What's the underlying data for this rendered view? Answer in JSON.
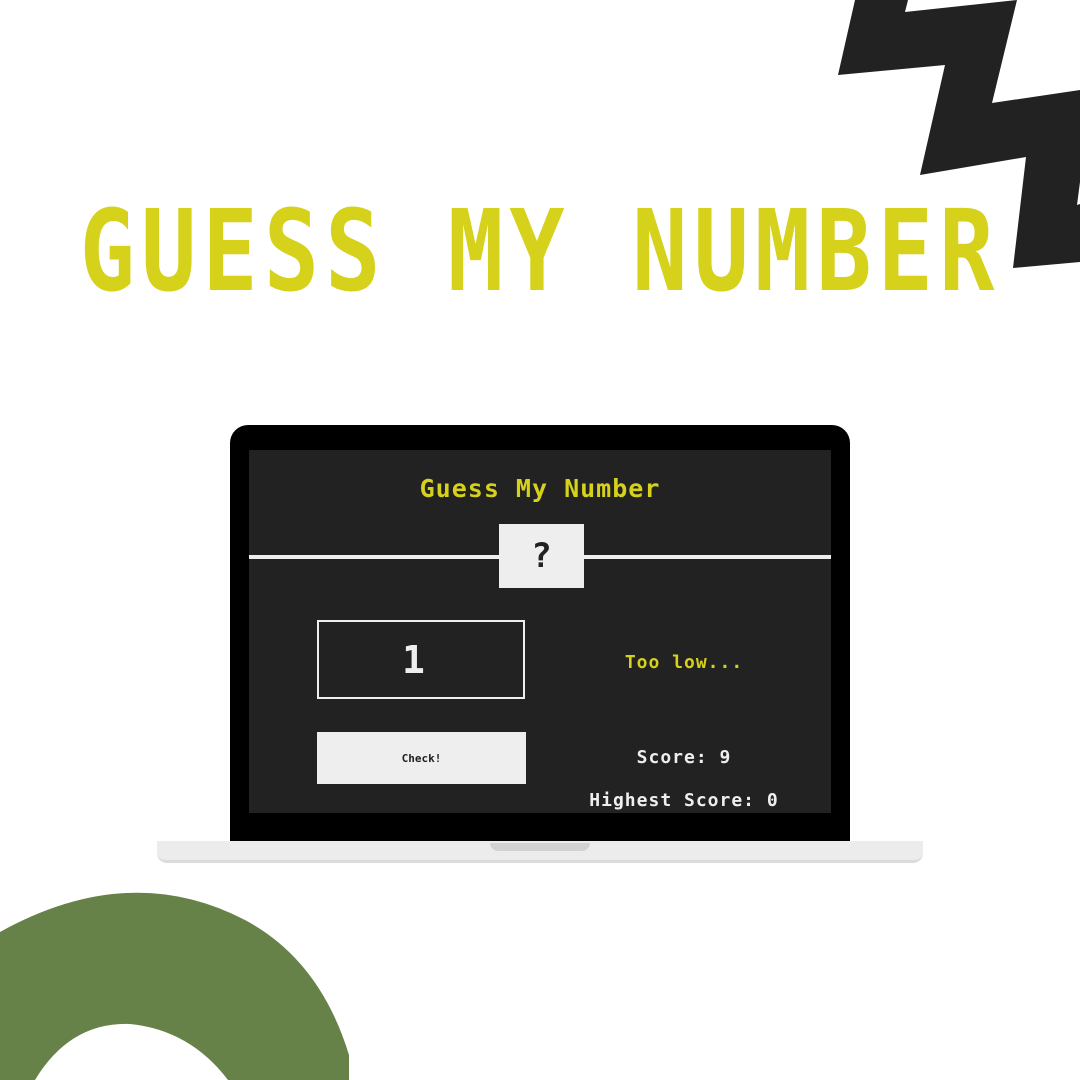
{
  "poster": {
    "headline": "GUESS MY NUMBER"
  },
  "game": {
    "title": "Guess My Number",
    "secret_number_display": "?",
    "guess_value": "1",
    "check_button_label": "Check!",
    "message": "Too low...",
    "score_text": "Score: 9",
    "highscore_text": "Highest Score: 0"
  },
  "colors": {
    "accent_yellow": "#d6d11b",
    "game_background": "#222222",
    "panel_light": "#eeeeee",
    "decor_green": "#678249",
    "decor_black": "#222222"
  },
  "icons": {
    "decor_top_right": "zigzag-shape",
    "decor_bottom_left": "arc-shape"
  }
}
